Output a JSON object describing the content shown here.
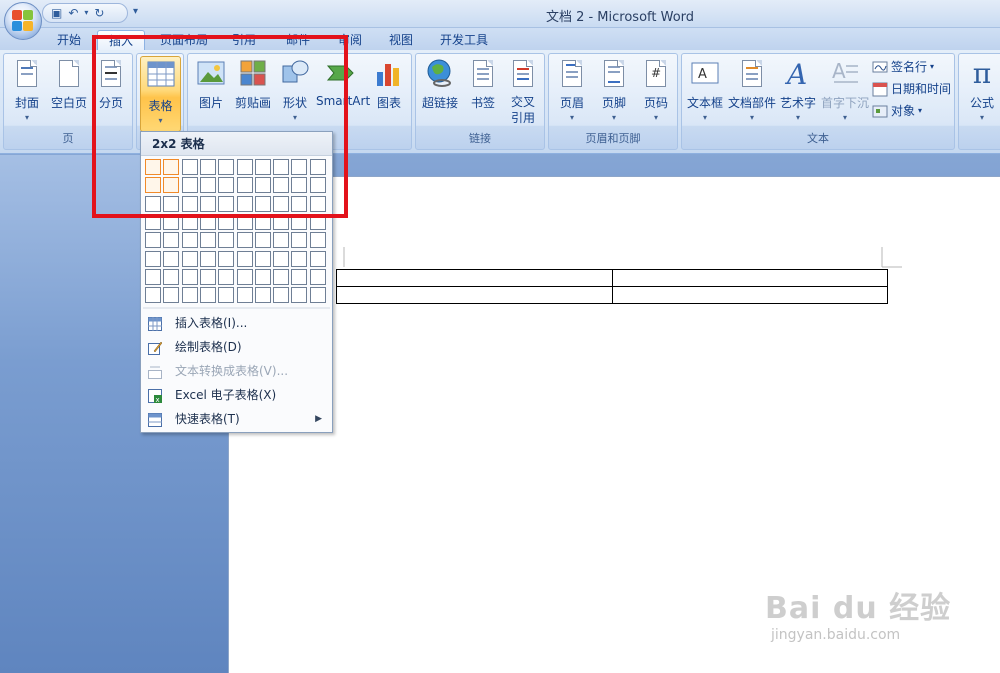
{
  "window": {
    "title": "文档 2 - Microsoft Word"
  },
  "quick_access": {
    "more_label": "▾"
  },
  "tabs": [
    {
      "label": "开始"
    },
    {
      "label": "插入"
    },
    {
      "label": "页面布局"
    },
    {
      "label": "引用"
    },
    {
      "label": "邮件"
    },
    {
      "label": "审阅"
    },
    {
      "label": "视图"
    },
    {
      "label": "开发工具"
    }
  ],
  "ribbon": {
    "groups": {
      "pages": {
        "label": "页",
        "buttons": [
          "封面",
          "空白页",
          "分页"
        ]
      },
      "tables": {
        "buttons": [
          "表格"
        ]
      },
      "illustrations": {
        "buttons": [
          "图片",
          "剪贴画",
          "形状",
          "SmartArt",
          "图表"
        ]
      },
      "links": {
        "label": "链接",
        "buttons": [
          "超链接",
          "书签",
          "交叉引用"
        ]
      },
      "header_footer": {
        "label": "页眉和页脚",
        "buttons": [
          "页眉",
          "页脚",
          "页码"
        ]
      },
      "text": {
        "label": "文本",
        "buttons": [
          "文本框",
          "文档部件",
          "艺术字",
          "首字下沉"
        ],
        "small": [
          "签名行",
          "日期和时间",
          "对象"
        ]
      },
      "symbols": {
        "buttons": [
          "公式"
        ]
      }
    }
  },
  "table_menu": {
    "header": "2x2 表格",
    "grid": {
      "cols": 10,
      "rows": 8,
      "selected_cols": 2,
      "selected_rows": 2
    },
    "items": [
      {
        "label": "插入表格(I)...",
        "disabled": false
      },
      {
        "label": "绘制表格(D)",
        "disabled": false
      },
      {
        "label": "文本转换成表格(V)...",
        "disabled": true
      },
      {
        "label": "Excel 电子表格(X)",
        "disabled": false
      },
      {
        "label": "快速表格(T)",
        "disabled": false,
        "submenu": true
      }
    ]
  },
  "document": {
    "table": {
      "rows": 2,
      "cols": 2
    }
  },
  "watermark": {
    "logo": "Bai du 经验",
    "sub": "jingyan.baidu.com"
  },
  "colors": {
    "highlight_box": "#e3121b",
    "selected_cell": "#f08a2a"
  }
}
